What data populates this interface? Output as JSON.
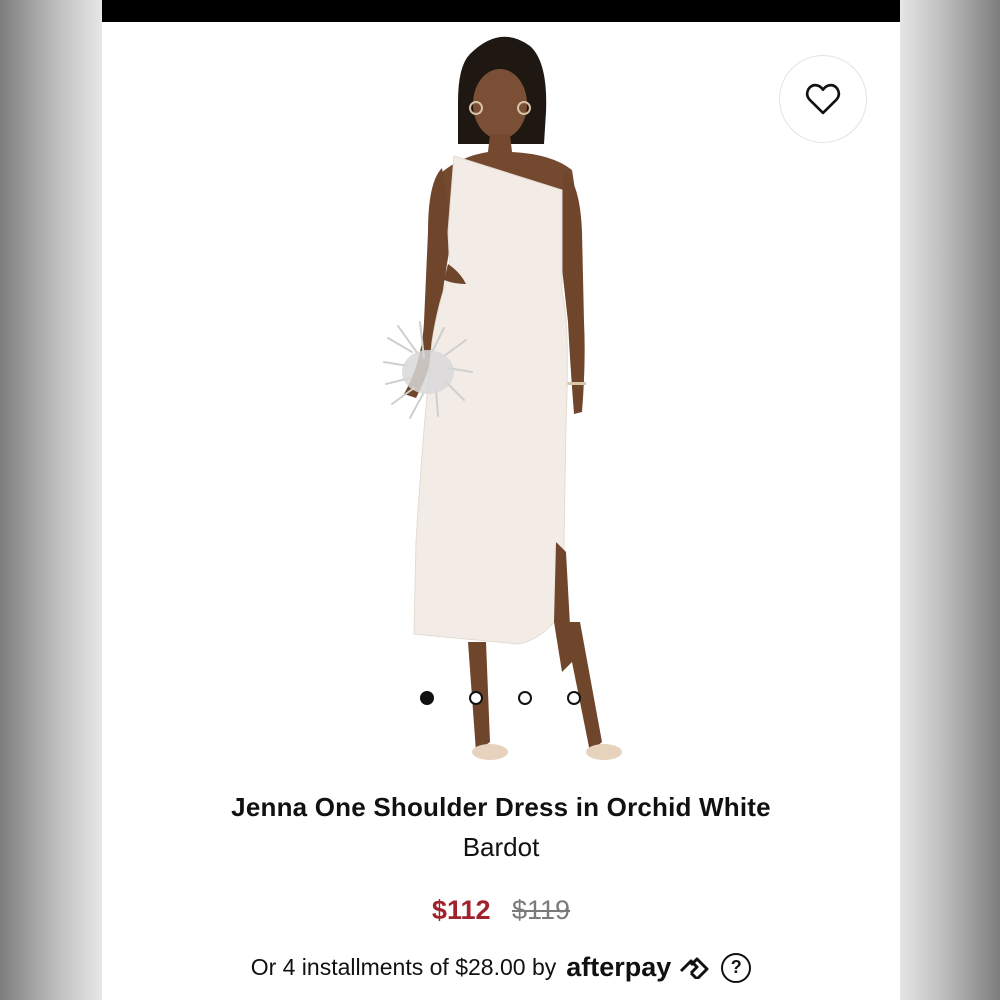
{
  "product": {
    "title": "Jenna One Shoulder Dress in Orchid White",
    "brand": "Bardot",
    "price_sale": "$112",
    "price_original": "$119"
  },
  "afterpay": {
    "installments_text": "Or 4 installments of $28.00 by",
    "logo_text": "afterpay",
    "help_label": "?"
  },
  "gallery": {
    "image_count": 4,
    "active_index": 0
  },
  "colors": {
    "sale_price": "#a1222a",
    "original_price": "#7a7a7a",
    "top_bar": "#000000",
    "dress": "#f3ece6"
  },
  "icons": {
    "favorite": "heart-outline-icon",
    "afterpay": "afterpay-arrows-icon"
  }
}
